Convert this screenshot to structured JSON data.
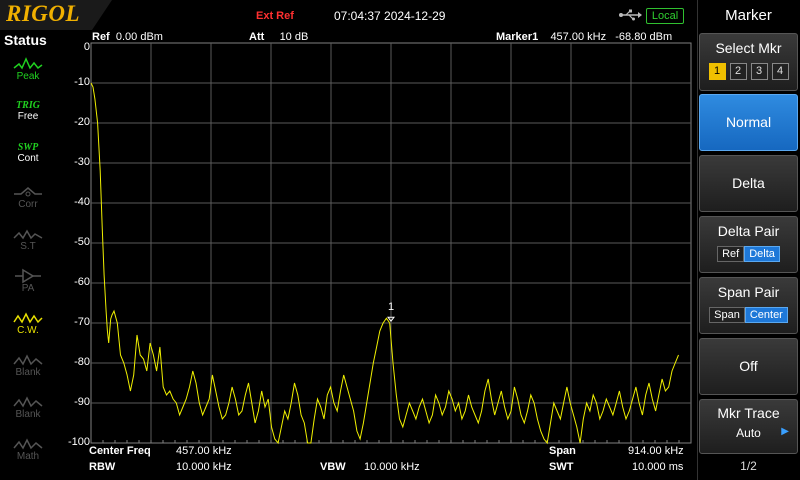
{
  "topbar": {
    "logo": "RIGOL",
    "ext_ref": "Ext Ref",
    "datetime": "07:04:37 2024-12-29",
    "remote_status": "Local"
  },
  "status": {
    "title": "Status",
    "items": [
      {
        "top": "",
        "bottom": "Peak",
        "icon": "peak-icon",
        "state": "on"
      },
      {
        "top": "TRIG",
        "bottom": "Free",
        "icon": "trig-text",
        "state": "on"
      },
      {
        "top": "SWP",
        "bottom": "Cont",
        "icon": "swp-text",
        "state": "on"
      },
      {
        "top": "",
        "bottom": "Corr",
        "icon": "corr-icon",
        "state": "off"
      },
      {
        "top": "",
        "bottom": "S.T",
        "icon": "st-icon",
        "state": "off"
      },
      {
        "top": "",
        "bottom": "PA",
        "icon": "pa-icon",
        "state": "off"
      },
      {
        "top": "",
        "bottom": "C.W.",
        "icon": "cw-icon",
        "state": "on"
      },
      {
        "top": "",
        "bottom": "Blank",
        "icon": "blank-icon",
        "state": "off"
      },
      {
        "top": "",
        "bottom": "Blank",
        "icon": "blank-icon",
        "state": "off"
      },
      {
        "top": "",
        "bottom": "Math",
        "icon": "math-icon",
        "state": "off"
      }
    ]
  },
  "header": {
    "ref_label": "Ref",
    "ref_value": "0.00 dBm",
    "att_label": "Att",
    "att_value": "10 dB",
    "marker_label": "Marker1",
    "marker_freq": "457.00 kHz",
    "marker_level": "-68.80 dBm"
  },
  "footer": {
    "center_label": "Center Freq",
    "center_value": "457.00 kHz",
    "span_label": "Span",
    "span_value": "914.00 kHz",
    "rbw_label": "RBW",
    "rbw_value": "10.000 kHz",
    "vbw_label": "VBW",
    "vbw_value": "10.000 kHz",
    "swt_label": "SWT",
    "swt_value": "10.000 ms"
  },
  "chart_data": {
    "type": "line",
    "ylim": [
      -100,
      0
    ],
    "yticks": [
      "0",
      "-10",
      "-20",
      "-30",
      "-40",
      "-50",
      "-60",
      "-70",
      "-80",
      "-90",
      "-100"
    ],
    "x_range_khz": [
      0,
      914
    ],
    "grid": true,
    "trace_color": "#f0f000",
    "marker": {
      "label": "1",
      "x_khz": 457,
      "y_dbm": -68.8
    },
    "series": [
      {
        "x_khz": [
          0,
          3,
          6,
          10,
          14,
          17,
          20,
          23,
          25,
          27,
          29,
          30,
          32,
          35,
          40,
          45,
          50,
          55,
          60,
          65,
          70,
          75,
          80,
          85,
          90,
          95,
          100,
          105,
          110,
          115,
          120,
          125,
          130,
          135,
          140,
          145,
          150,
          155,
          160,
          165,
          170,
          175,
          180,
          185,
          190,
          195,
          200,
          205,
          210,
          215,
          220,
          225,
          230,
          235,
          240,
          245,
          250,
          255,
          260,
          265,
          270,
          275,
          280,
          285,
          290,
          295,
          300,
          305,
          310,
          315,
          320,
          325,
          330,
          335,
          340,
          345,
          350,
          355,
          360,
          365,
          370,
          375,
          380,
          385,
          390,
          395,
          400,
          405,
          410,
          415,
          420,
          425,
          430,
          435,
          440,
          445,
          450,
          455,
          457,
          460,
          465,
          470,
          475,
          480,
          485,
          490,
          495,
          500,
          505,
          510,
          515,
          520,
          525,
          530,
          535,
          540,
          545,
          550,
          555,
          560,
          565,
          570,
          575,
          580,
          585,
          590,
          595,
          600,
          605,
          610,
          615,
          620,
          625,
          630,
          635,
          640,
          645,
          650,
          655,
          660,
          665,
          670,
          675,
          680,
          685,
          690,
          695,
          700,
          705,
          710,
          715,
          720,
          725,
          730,
          735,
          740,
          745,
          750,
          755,
          760,
          765,
          770,
          775,
          780,
          785,
          790,
          795,
          800,
          805,
          810,
          815,
          820,
          825,
          830,
          835,
          840,
          845,
          850,
          855,
          860,
          865,
          870,
          875,
          880,
          885,
          890,
          895,
          900,
          905,
          908,
          911,
          914
        ],
        "y_dbm": [
          -10,
          -11,
          -14,
          -20,
          -32,
          -46,
          -58,
          -67,
          -72,
          -75,
          -71,
          -69,
          -68,
          -67,
          -70,
          -78,
          -80,
          -83,
          -87,
          -83,
          -73,
          -78,
          -79,
          -82,
          -75,
          -78,
          -82,
          -76,
          -86,
          -88,
          -87,
          -89,
          -90,
          -93,
          -91,
          -89,
          -86,
          -82,
          -85,
          -90,
          -93,
          -91,
          -89,
          -83,
          -87,
          -91,
          -94,
          -93,
          -90,
          -86,
          -89,
          -93,
          -92,
          -88,
          -85,
          -90,
          -95,
          -92,
          -87,
          -91,
          -89,
          -96,
          -99,
          -101,
          -96,
          -92,
          -94,
          -90,
          -85,
          -88,
          -93,
          -95,
          -101,
          -100,
          -94,
          -89,
          -91,
          -94,
          -88,
          -86,
          -90,
          -92,
          -87,
          -83,
          -86,
          -89,
          -92,
          -97,
          -99,
          -95,
          -90,
          -85,
          -80,
          -76,
          -72,
          -70,
          -68.8,
          -70,
          -74,
          -80,
          -88,
          -94,
          -96,
          -93,
          -90,
          -92,
          -94,
          -91,
          -89,
          -92,
          -95,
          -93,
          -88,
          -90,
          -93,
          -91,
          -87,
          -89,
          -92,
          -90,
          -94,
          -92,
          -88,
          -91,
          -93,
          -95,
          -92,
          -87,
          -84,
          -89,
          -93,
          -90,
          -87,
          -91,
          -94,
          -92,
          -86,
          -89,
          -93,
          -95,
          -92,
          -88,
          -90,
          -94,
          -97,
          -99,
          -101,
          -95,
          -90,
          -92,
          -94,
          -90,
          -86,
          -90,
          -93,
          -96,
          -101,
          -94,
          -90,
          -92,
          -88,
          -90,
          -94,
          -92,
          -89,
          -91,
          -93,
          -90,
          -87,
          -91,
          -94,
          -92,
          -89,
          -86,
          -90,
          -93,
          -88,
          -85,
          -89,
          -92,
          -88,
          -84,
          -87,
          -86,
          -82,
          -80,
          -78
        ]
      }
    ]
  },
  "menu": {
    "title": "Marker",
    "select_label": "Select Mkr",
    "markers": [
      "1",
      "2",
      "3",
      "4"
    ],
    "normal": "Normal",
    "delta": "Delta",
    "delta_pair_label": "Delta Pair",
    "delta_pair_a": "Ref",
    "delta_pair_b": "Delta",
    "span_pair_label": "Span Pair",
    "span_pair_a": "Span",
    "span_pair_b": "Center",
    "off": "Off",
    "mkr_trace_label": "Mkr Trace",
    "mkr_trace_value": "Auto",
    "page": "1/2"
  }
}
